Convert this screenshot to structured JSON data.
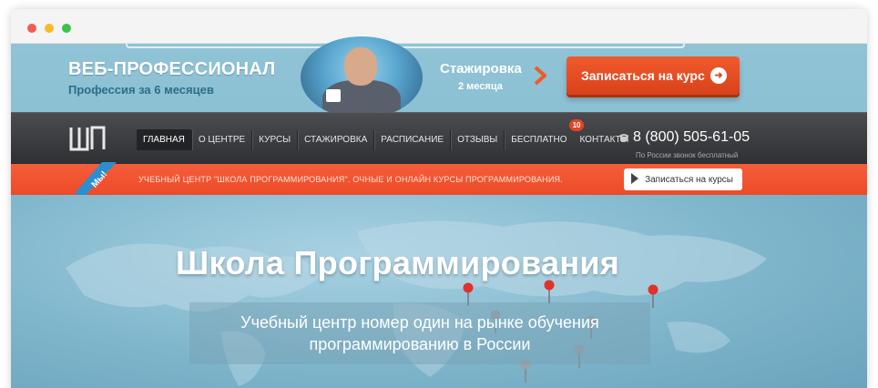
{
  "promo": {
    "title": "ВЕБ-ПРОФЕССИОНАЛ",
    "subtitle": "Профессия за 6 месяцев",
    "internship_title": "Стажировка",
    "internship_sub": "2 месяца",
    "enroll_label": "Записаться на курс"
  },
  "nav": {
    "items": [
      {
        "label": "ГЛАВНАЯ",
        "active": true
      },
      {
        "label": "О ЦЕНТРЕ"
      },
      {
        "label": "КУРСЫ"
      },
      {
        "label": "СТАЖИРОВКА"
      },
      {
        "label": "РАСПИСАНИЕ"
      },
      {
        "label": "ОТЗЫВЫ"
      },
      {
        "label": "БЕСПЛАТНО",
        "badge": "10"
      },
      {
        "label": "КОНТАКТЫ"
      }
    ],
    "phone": "8 (800) 505-61-05",
    "phone_note": "По России звонок бесплатный"
  },
  "strip": {
    "ribbon": "Мы!",
    "text": "УЧЕБНЫЙ ЦЕНТР \"ШКОЛА ПРОГРАММИРОВАНИЯ\". ОЧНЫЕ И ОНЛАЙН КУРСЫ ПРОГРАММИРОВАНИЯ.",
    "button_label": "Записаться на курсы"
  },
  "hero": {
    "title": "Школа Программирования",
    "line1": "Учебный центр номер один на рынке обучения",
    "line2": "программированию в России"
  },
  "colors": {
    "accent_orange": "#ec4b28",
    "nav_dark": "#2f3034",
    "sky_blue": "#8cc0d3"
  }
}
